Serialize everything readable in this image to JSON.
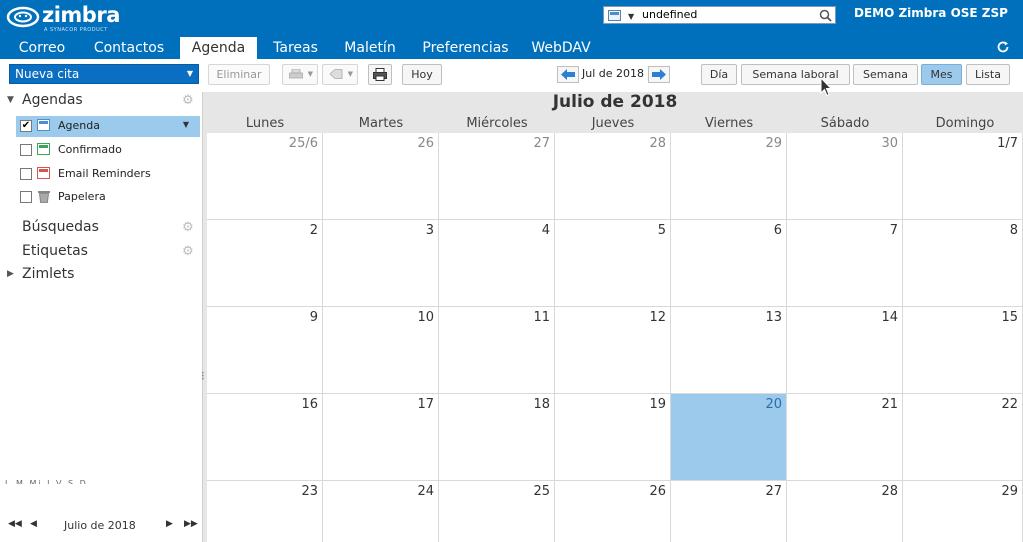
{
  "header": {
    "logo_text": "zimbra",
    "logo_sub": "A SYNACOR PRODUCT",
    "search": {
      "value": "undefined",
      "type_icon": "calendar-icon"
    },
    "user": "DEMO Zimbra OSE ZSP"
  },
  "app_tabs": [
    "Correo",
    "Contactos",
    "Agenda",
    "Tareas",
    "Maletín",
    "Preferencias",
    "WebDAV"
  ],
  "active_tab": "Agenda",
  "sidebar": {
    "new_button": "Nueva cita",
    "agendas_header": "Agendas",
    "calendars": [
      {
        "name": "Agenda",
        "checked": true,
        "color": "#4c8fd0"
      },
      {
        "name": "Confirmado",
        "checked": false,
        "color": "#3aa65a"
      },
      {
        "name": "Email Reminders",
        "checked": false,
        "color": "#d9534f"
      },
      {
        "name": "Papelera",
        "checked": false,
        "color": "#888888"
      }
    ],
    "searches_header": "Búsquedas",
    "tags_header": "Etiquetas",
    "zimlets_header": "Zimlets",
    "mini_month": "Julio de 2018",
    "mini_days": "L M Mi J V S D"
  },
  "toolbar": {
    "delete": "Eliminar",
    "today": "Hoy",
    "range_label": "Jul de 2018",
    "views": [
      "Día",
      "Semana laboral",
      "Semana",
      "Mes",
      "Lista"
    ],
    "active_view": "Mes"
  },
  "calendar": {
    "title": "Julio de 2018",
    "weekdays": [
      "Lunes",
      "Martes",
      "Miércoles",
      "Jueves",
      "Viernes",
      "Sábado",
      "Domingo"
    ],
    "weeks": [
      [
        "25/6",
        "26",
        "27",
        "28",
        "29",
        "30",
        "1/7"
      ],
      [
        "2",
        "3",
        "4",
        "5",
        "6",
        "7",
        "8"
      ],
      [
        "9",
        "10",
        "11",
        "12",
        "13",
        "14",
        "15"
      ],
      [
        "16",
        "17",
        "18",
        "19",
        "20",
        "21",
        "22"
      ],
      [
        "23",
        "24",
        "25",
        "26",
        "27",
        "28",
        "29"
      ]
    ],
    "other_month_first_week": 6,
    "today": "20",
    "colors": {
      "today": "#9ccaec",
      "header_bg": "#0070bc"
    }
  }
}
